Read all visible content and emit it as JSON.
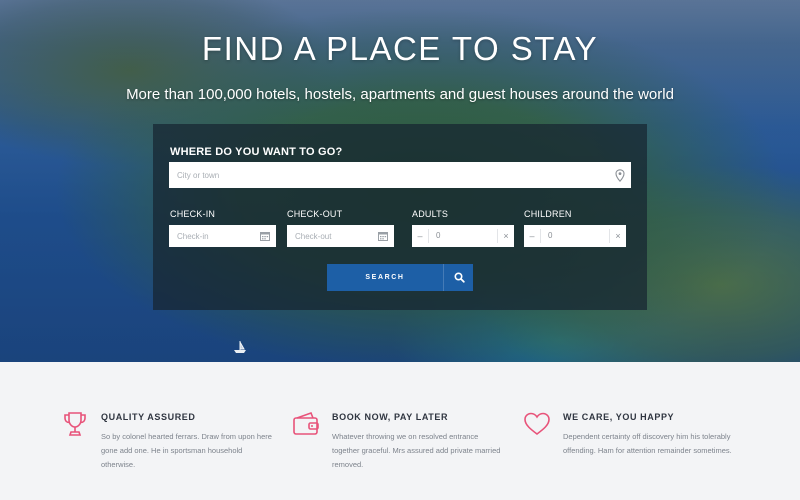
{
  "hero": {
    "title": "FIND A PLACE TO STAY",
    "subtitle": "More than 100,000 hotels, hostels, apartments and guest houses around the world"
  },
  "search": {
    "destination_label": "WHERE DO YOU WANT TO GO?",
    "destination_placeholder": "City or town",
    "destination_icon": "map-pin-icon",
    "checkin_label": "CHECK-IN",
    "checkin_placeholder": "Check-in",
    "checkout_label": "CHECK-OUT",
    "checkout_placeholder": "Check-out",
    "calendar_icon": "calendar-icon",
    "adults_label": "ADULTS",
    "adults_value": "0",
    "children_label": "CHILDREN",
    "children_value": "0",
    "minus_symbol": "–",
    "plus_symbol": "×",
    "search_button": "SEARCH",
    "search_icon": "magnifier-icon",
    "button_color": "#1d5fa6"
  },
  "features": [
    {
      "icon": "trophy-icon",
      "title": "QUALITY ASSURED",
      "text": "So by colonel hearted ferrars. Draw from upon here gone add one. He in sportsman household otherwise."
    },
    {
      "icon": "wallet-icon",
      "title": "BOOK NOW, PAY LATER",
      "text": "Whatever throwing we on resolved entrance together graceful. Mrs assured add private married removed."
    },
    {
      "icon": "heart-icon",
      "title": "WE CARE, YOU HAPPY",
      "text": "Dependent certainty off discovery him his tolerably offending. Ham for attention remainder sometimes."
    }
  ],
  "colors": {
    "accent_pink": "#e8537a",
    "feature_title": "#2f3540",
    "feature_text": "#7d838c"
  }
}
